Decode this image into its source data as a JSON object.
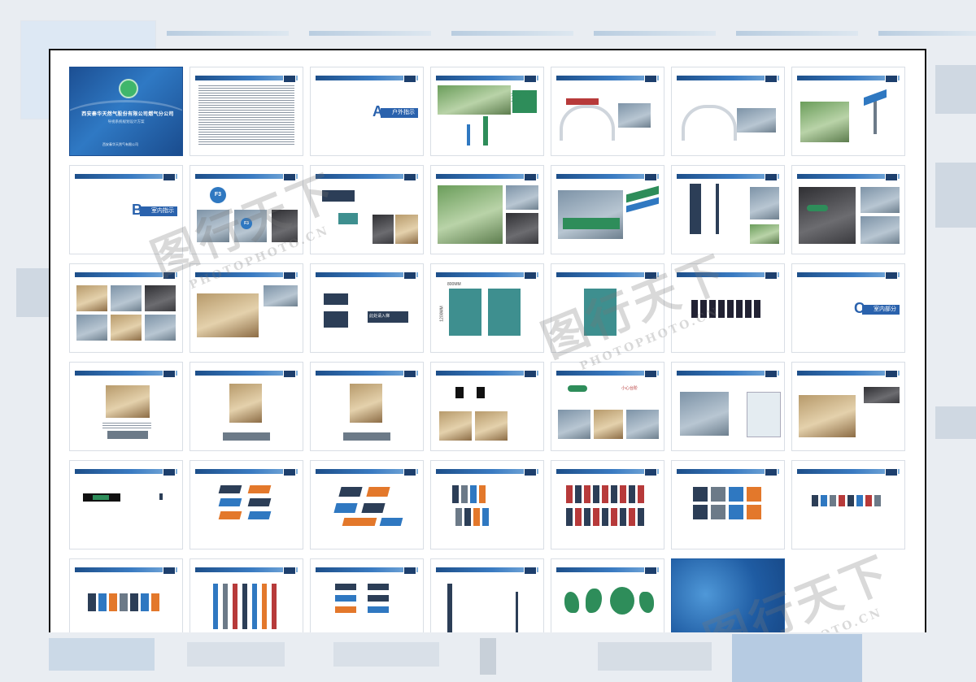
{
  "cover": {
    "title": "西安秦华天然气股份有限公司燃气分公司",
    "subtitle": "导视系统规划设计方案",
    "publisher": "西安秦华天然气有限公司"
  },
  "sections": {
    "a": {
      "letter": "A",
      "label": "户外指示系统"
    },
    "b": {
      "letter": "B",
      "label": "室内指示系统"
    },
    "c": {
      "letter": "C",
      "label": "室内部分装饰"
    }
  },
  "signs": {
    "floor": "F3",
    "green_slogan": "天然之气 清洁之源",
    "welcome": "欢迎您的光临",
    "elevator": "此处请入梯",
    "dimension_w": "800MM",
    "dimension_h": "1200MM",
    "careful": "小心台阶"
  },
  "watermark": {
    "chinese": "图行天下",
    "latin": "PHOTOPHOTO.CN"
  }
}
